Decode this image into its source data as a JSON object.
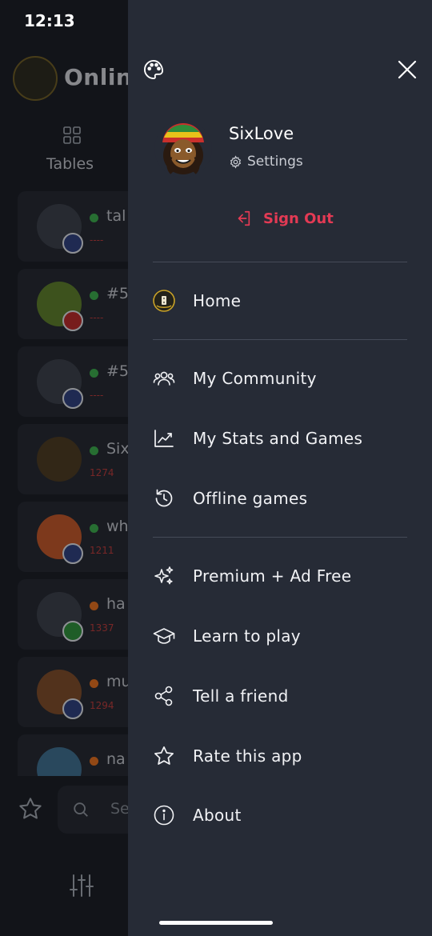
{
  "status_bar": {
    "time": "12:13"
  },
  "background": {
    "title": "Online",
    "tab_label": "Tables",
    "search_placeholder": "Se",
    "cards": [
      {
        "name": "tal",
        "rating": "----",
        "status_color": "#3aa34a"
      },
      {
        "name": "#5",
        "rating": "----",
        "status_color": "#3aa34a"
      },
      {
        "name": "#5",
        "rating": "----",
        "status_color": "#3aa34a"
      },
      {
        "name": "Six",
        "rating": "1274",
        "status_color": "#3aa34a"
      },
      {
        "name": "wh",
        "rating": "1211",
        "status_color": "#3aa34a"
      },
      {
        "name": "ha",
        "rating": "1337",
        "status_color": "#d86a1f"
      },
      {
        "name": "mu",
        "rating": "1294",
        "status_color": "#d86a1f"
      },
      {
        "name": "na",
        "rating": "",
        "status_color": "#d86a1f"
      }
    ]
  },
  "drawer": {
    "user": {
      "name": "SixLove",
      "settings_label": "Settings",
      "sign_out_label": "Sign Out"
    },
    "menu": [
      {
        "label": "Home",
        "icon": "sixlove-logo-icon"
      },
      {
        "label": "My Community",
        "icon": "community-icon"
      },
      {
        "label": "My Stats and Games",
        "icon": "stats-chart-icon"
      },
      {
        "label": "Offline games",
        "icon": "history-icon"
      },
      {
        "label": "Premium + Ad Free",
        "icon": "sparkles-icon"
      },
      {
        "label": "Learn to play",
        "icon": "graduation-cap-icon"
      },
      {
        "label": "Tell a friend",
        "icon": "share-icon"
      },
      {
        "label": "Rate this app",
        "icon": "star-icon"
      },
      {
        "label": "About",
        "icon": "info-icon"
      }
    ]
  },
  "colors": {
    "accent_red": "#e33a54",
    "drawer_bg": "#262b36",
    "online": "#3aa34a",
    "away": "#d86a1f"
  }
}
